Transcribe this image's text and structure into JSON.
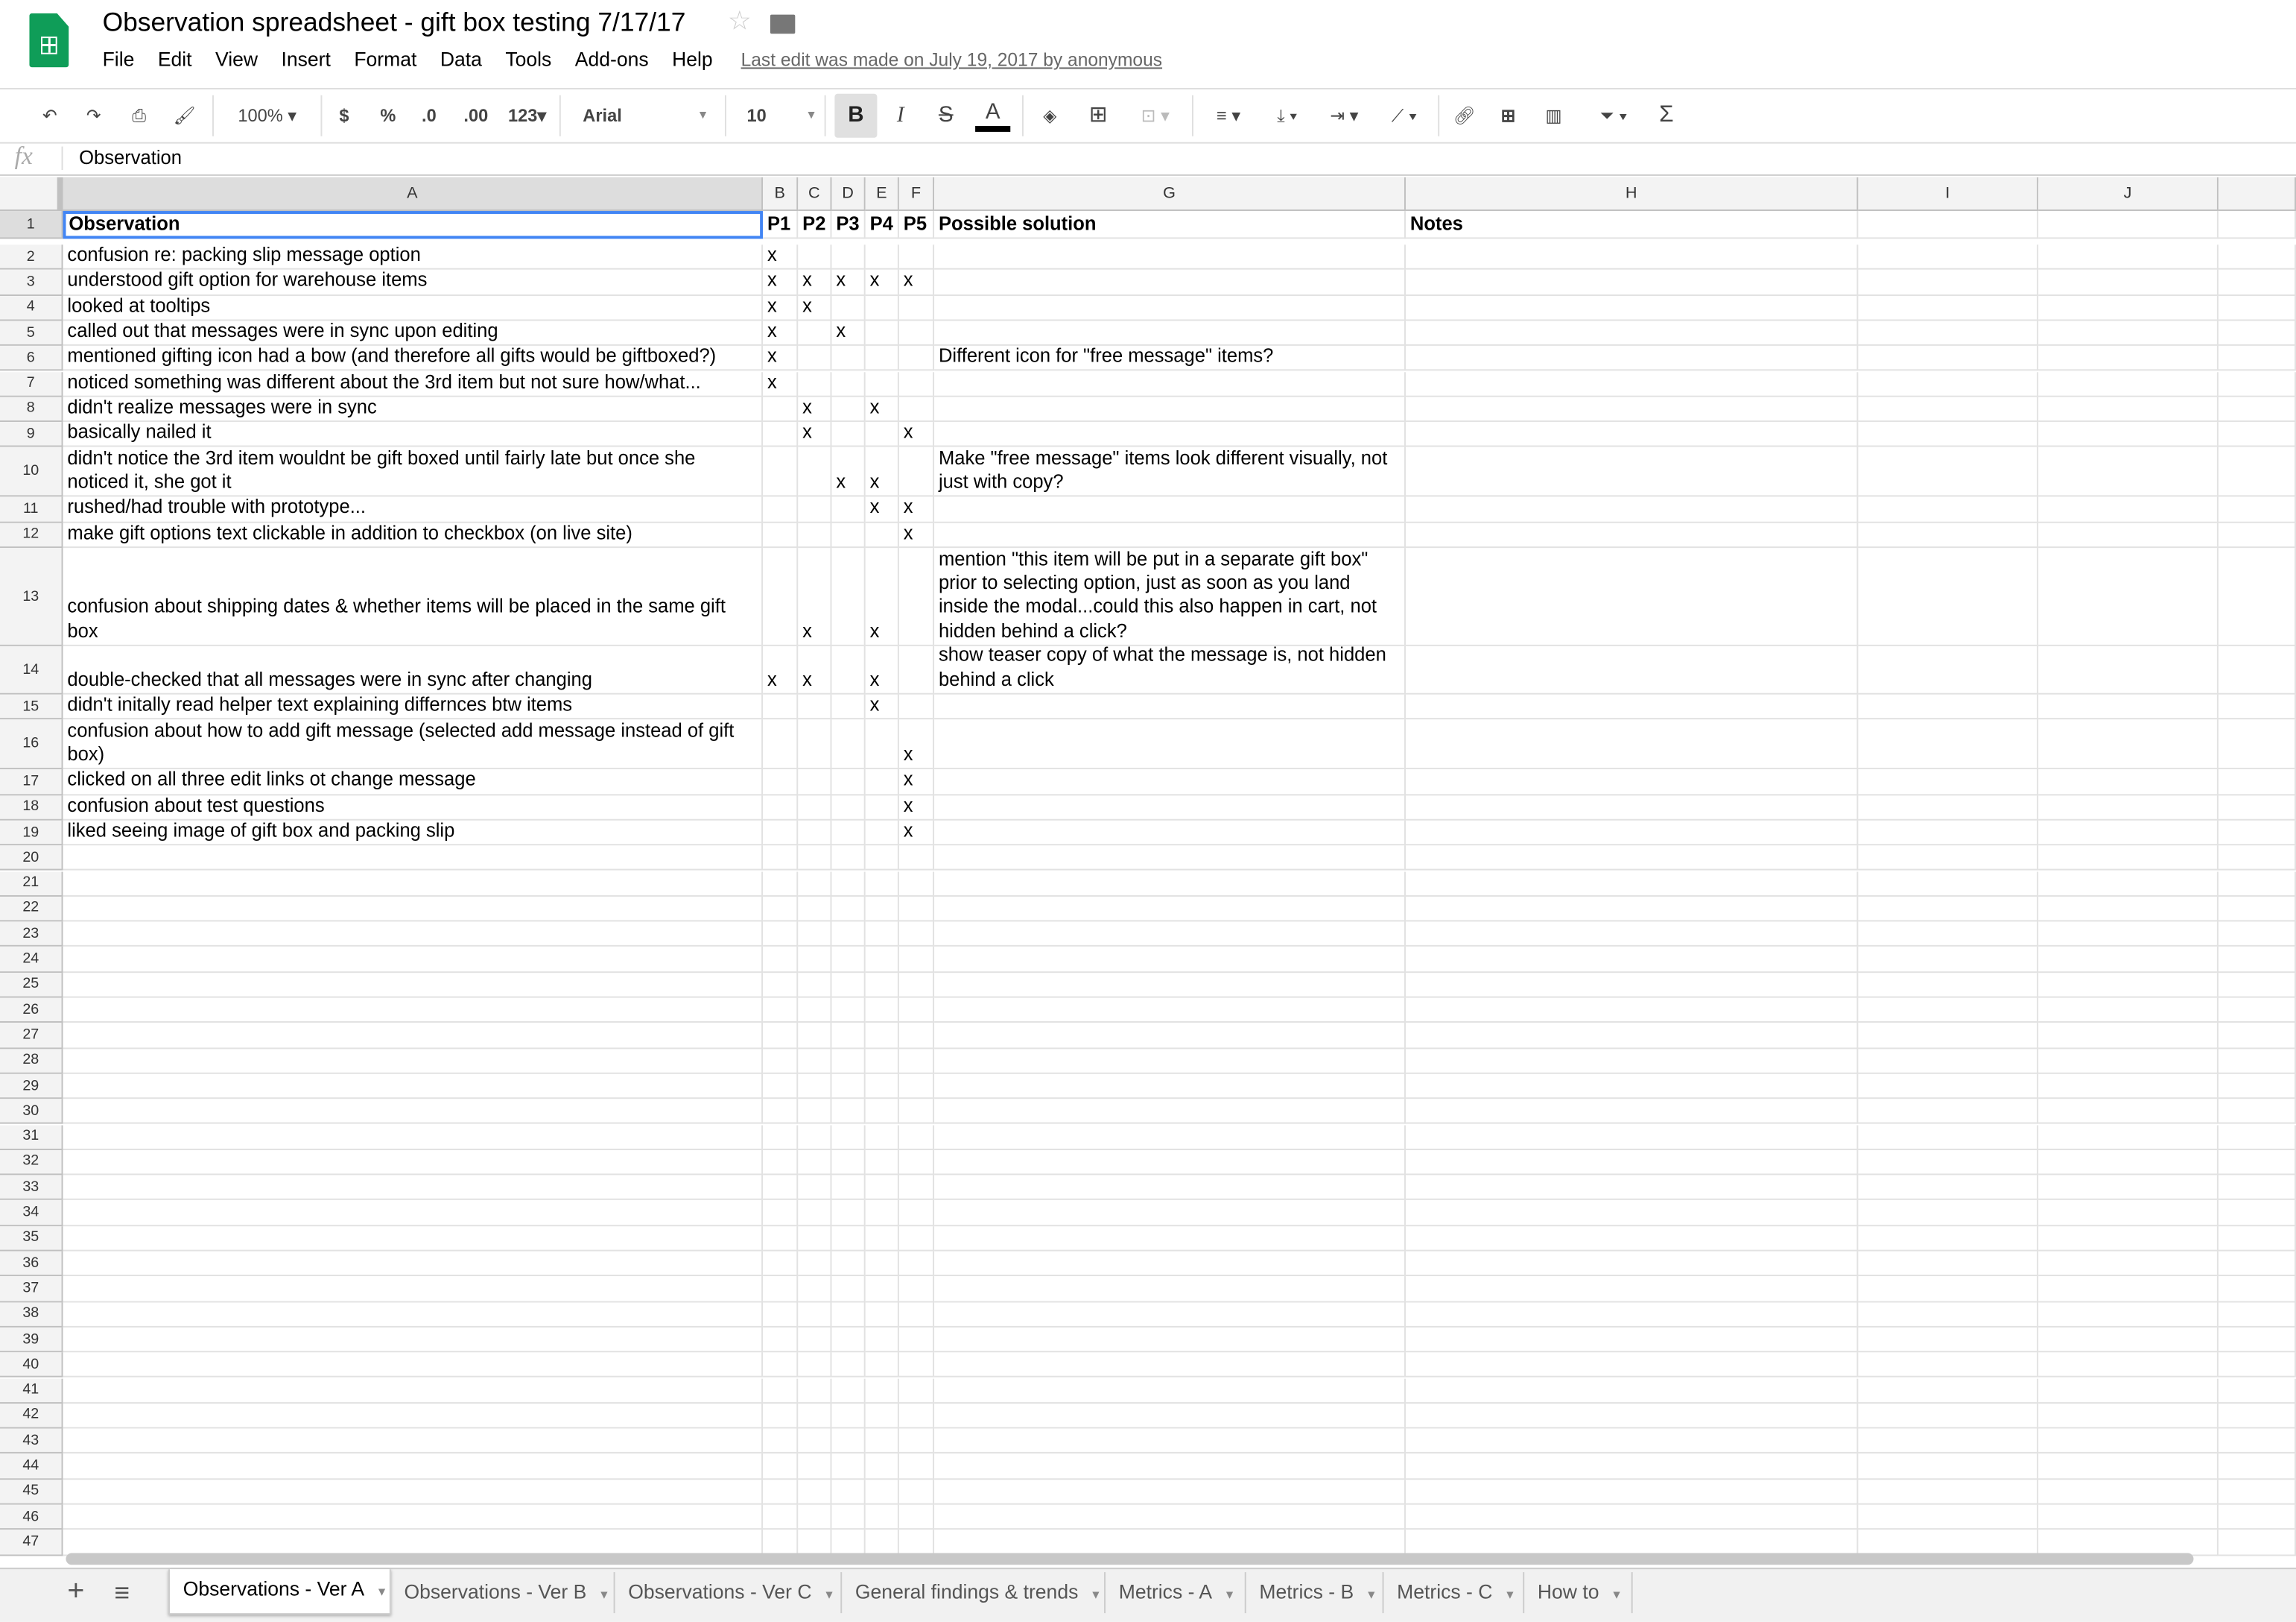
{
  "app": {
    "title": "Observation spreadsheet - gift box testing 7/17/17",
    "last_edit": "Last edit was made on July 19, 2017 by anonymous",
    "menu": [
      "File",
      "Edit",
      "View",
      "Insert",
      "Format",
      "Data",
      "Tools",
      "Add-ons",
      "Help"
    ]
  },
  "toolbar": {
    "zoom": "100%",
    "currency": "$",
    "percent": "%",
    "dec_less": ".0",
    "dec_more": ".00",
    "format": "123",
    "font": "Arial",
    "size": "10",
    "bold": "B",
    "italic": "I",
    "strike": "S",
    "textcolor": "A",
    "fx": "fx"
  },
  "formula_bar": {
    "value": "Observation"
  },
  "columns": [
    "A",
    "B",
    "C",
    "D",
    "E",
    "F",
    "G",
    "H",
    "I",
    "J"
  ],
  "header_row": [
    "Observation",
    "P1",
    "P2",
    "P3",
    "P4",
    "P5",
    "Possible solution",
    "Notes"
  ],
  "rows": [
    {
      "n": "2",
      "a": "confusion re: packing slip message option",
      "x": [
        1,
        0,
        0,
        0,
        0
      ],
      "g": ""
    },
    {
      "n": "3",
      "a": "understood gift option for warehouse items",
      "x": [
        1,
        1,
        1,
        1,
        1
      ],
      "g": ""
    },
    {
      "n": "4",
      "a": "looked at tooltips",
      "x": [
        1,
        1,
        0,
        0,
        0
      ],
      "g": ""
    },
    {
      "n": "5",
      "a": "called out that messages were in sync upon editing",
      "x": [
        1,
        0,
        1,
        0,
        0
      ],
      "g": ""
    },
    {
      "n": "6",
      "a": "mentioned gifting icon had a bow (and therefore all gifts would be giftboxed?)",
      "x": [
        1,
        0,
        0,
        0,
        0
      ],
      "g": "Different icon for \"free message\" items?"
    },
    {
      "n": "7",
      "a": "noticed something was different about the 3rd item but not sure how/what...",
      "x": [
        1,
        0,
        0,
        0,
        0
      ],
      "g": ""
    },
    {
      "n": "8",
      "a": "didn't realize messages were in sync",
      "x": [
        0,
        1,
        0,
        1,
        0
      ],
      "g": ""
    },
    {
      "n": "9",
      "a": "basically nailed it",
      "x": [
        0,
        1,
        0,
        0,
        1
      ],
      "g": ""
    },
    {
      "n": "10",
      "a": "didn't notice the 3rd item wouldnt be gift boxed until fairly late but once she noticed it, she got it",
      "x": [
        0,
        0,
        1,
        1,
        0
      ],
      "g": "Make \"free message\" items look different visually, not just with copy?"
    },
    {
      "n": "11",
      "a": "rushed/had trouble with prototype...",
      "x": [
        0,
        0,
        0,
        1,
        1
      ],
      "g": ""
    },
    {
      "n": "12",
      "a": "make gift options text clickable in addition to checkbox (on live site)",
      "x": [
        0,
        0,
        0,
        0,
        1
      ],
      "g": ""
    },
    {
      "n": "13",
      "a": "confusion about shipping dates & whether items will be placed in the same gift box",
      "x": [
        0,
        1,
        0,
        1,
        0
      ],
      "g": "mention \"this item will be put in a separate gift box\" prior to selecting option, just as soon as you land inside the modal...could this also happen in cart, not hidden behind a click?"
    },
    {
      "n": "14",
      "a": "double-checked that all messages were in sync after changing",
      "x": [
        1,
        1,
        0,
        1,
        0
      ],
      "g": "show teaser copy of what the message is, not hidden behind a click"
    },
    {
      "n": "15",
      "a": "didn't initally read helper text explaining differnces btw items",
      "x": [
        0,
        0,
        0,
        1,
        0
      ],
      "g": ""
    },
    {
      "n": "16",
      "a": "confusion about how to add gift message (selected add message instead of gift box)",
      "x": [
        0,
        0,
        0,
        0,
        1
      ],
      "g": ""
    },
    {
      "n": "17",
      "a": "clicked on all three edit links ot change message",
      "x": [
        0,
        0,
        0,
        0,
        1
      ],
      "g": ""
    },
    {
      "n": "18",
      "a": "confusion about test questions",
      "x": [
        0,
        0,
        0,
        0,
        1
      ],
      "g": ""
    },
    {
      "n": "19",
      "a": "liked seeing image of gift box and packing slip",
      "x": [
        0,
        0,
        0,
        0,
        1
      ],
      "g": ""
    }
  ],
  "mark": "x",
  "empty_rows_from": 20,
  "empty_rows_to": 47,
  "tabs": [
    "Observations - Ver A",
    "Observations - Ver B",
    "Observations - Ver C",
    "General findings & trends",
    "Metrics - A",
    "Metrics - B",
    "Metrics - C",
    "How to"
  ],
  "tabs_add": "+",
  "tabs_list": "≡",
  "colors": {
    "sheets_green": "#0f9d58",
    "selection": "#4285f4"
  }
}
